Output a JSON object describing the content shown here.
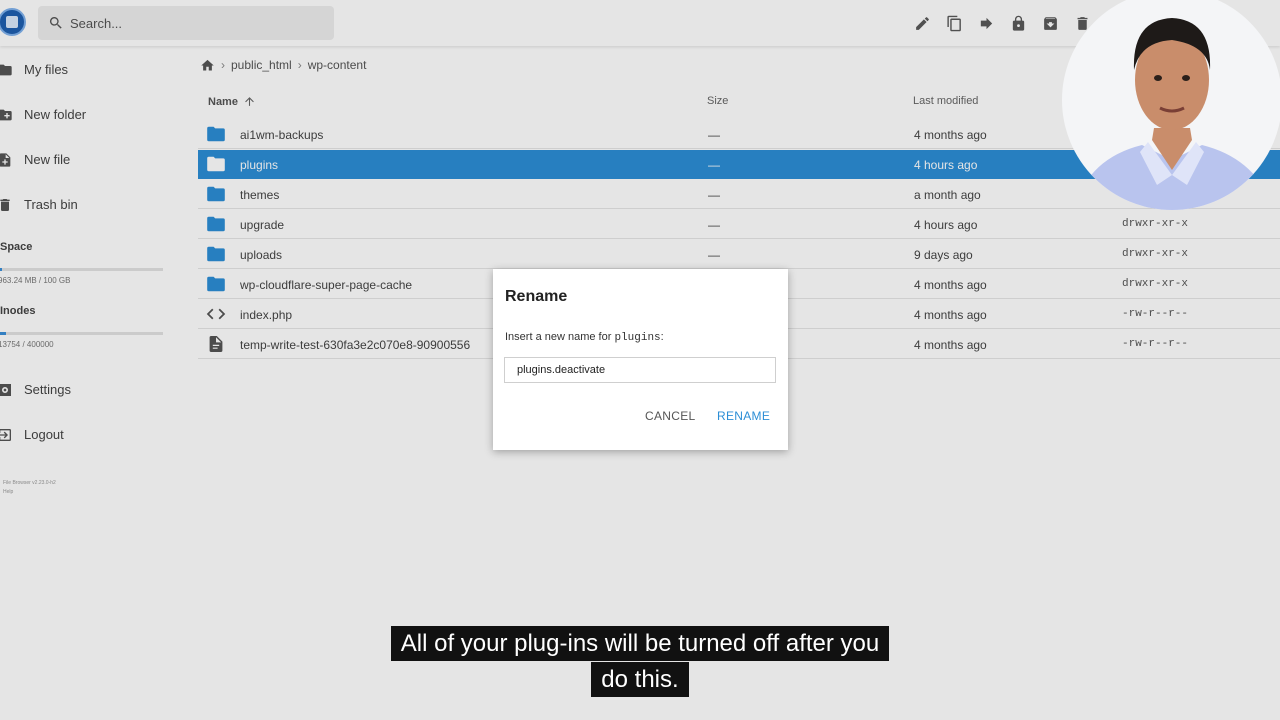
{
  "header": {
    "search_placeholder": "Search..."
  },
  "sidebar": {
    "items": [
      {
        "label": "My files",
        "icon": "folder-icon"
      },
      {
        "label": "New folder",
        "icon": "create-folder-icon"
      },
      {
        "label": "New file",
        "icon": "note-add-icon"
      },
      {
        "label": "Trash bin",
        "icon": "trash-icon"
      }
    ],
    "space": {
      "title": "Space",
      "value": "963.24 MB / 100 GB",
      "fraction": 0.01
    },
    "inodes": {
      "title": "Inodes",
      "value": "13754 / 400000",
      "fraction": 0.034
    },
    "settings_label": "Settings",
    "logout_label": "Logout",
    "version_line1": "File Browser v2.23.0-h2",
    "version_line2": "Help"
  },
  "breadcrumb": {
    "items": [
      "public_html",
      "wp-content"
    ]
  },
  "list": {
    "headers": {
      "name": "Name",
      "size": "Size",
      "modified": "Last modified"
    },
    "rows": [
      {
        "name": "ai1wm-backups",
        "size": "—",
        "modified": "4 months ago",
        "perm": "",
        "type": "folder"
      },
      {
        "name": "plugins",
        "size": "—",
        "modified": "4 hours ago",
        "perm": "",
        "type": "folder"
      },
      {
        "name": "themes",
        "size": "—",
        "modified": "a month ago",
        "perm": "",
        "type": "folder"
      },
      {
        "name": "upgrade",
        "size": "—",
        "modified": "4 hours ago",
        "perm": "drwxr-xr-x",
        "type": "folder"
      },
      {
        "name": "uploads",
        "size": "—",
        "modified": "9 days ago",
        "perm": "drwxr-xr-x",
        "type": "folder"
      },
      {
        "name": "wp-cloudflare-super-page-cache",
        "size": "",
        "modified": "4 months ago",
        "perm": "drwxr-xr-x",
        "type": "folder"
      },
      {
        "name": "index.php",
        "size": "",
        "modified": "4 months ago",
        "perm": "-rw-r--r--",
        "type": "code"
      },
      {
        "name": "temp-write-test-630fa3e2c070e8-90900556",
        "size": "",
        "modified": "4 months ago",
        "perm": "-rw-r--r--",
        "type": "file"
      }
    ]
  },
  "dialog": {
    "title": "Rename",
    "prompt_prefix": "Insert a new name for",
    "prompt_target": "plugins",
    "prompt_suffix": ":",
    "input_value": "plugins.deactivate",
    "cancel_label": "CANCEL",
    "rename_label": "RENAME"
  },
  "captions": {
    "line1": "All of your plug-ins will be turned off after you",
    "line2": "do this."
  },
  "colors": {
    "accent": "#2c8ed6",
    "selected_row": "#2c8ed6"
  }
}
